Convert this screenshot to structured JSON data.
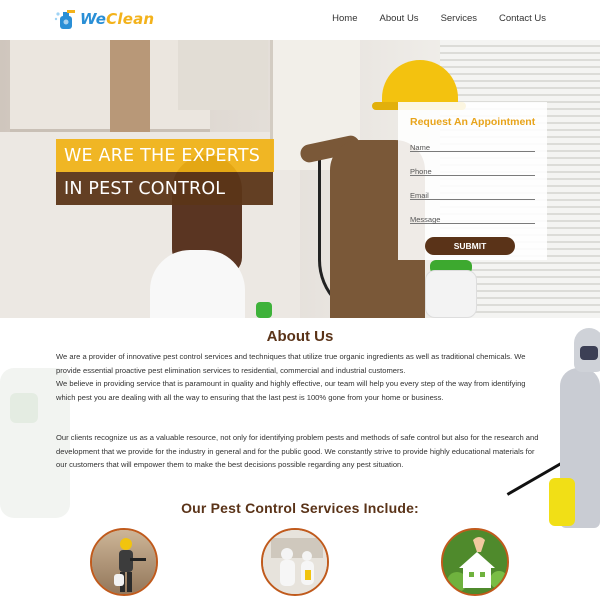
{
  "header": {
    "logo_text_a": "We",
    "logo_text_b": "Clean",
    "nav": [
      {
        "label": "Home"
      },
      {
        "label": "About Us"
      },
      {
        "label": "Services"
      },
      {
        "label": "Contact Us"
      }
    ]
  },
  "hero": {
    "line1": "WE ARE THE EXPERTS",
    "line2": "IN PEST CONTROL"
  },
  "appointment": {
    "title": "Request An Appointment",
    "fields": {
      "name": "Name",
      "phone": "Phone",
      "email": "Email",
      "message": "Message"
    },
    "submit": "SUBMIT"
  },
  "about": {
    "title": "About Us",
    "paragraph1": "We are a provider of innovative pest control services and techniques that utilize true organic ingredients as well as traditional chemicals. We provide essential proactive pest elimination services to residential, commercial and industrial customers.",
    "paragraph1b": "We believe in providing service that is paramount in quality and highly effective, our team will help you every step of the way from identifying which pest you are dealing with all the way to ensuring that the last pest is 100% gone from your home or business.",
    "paragraph2": "Our clients recognize us as a valuable resource, not only for identifying problem pests and methods of safe control but also for the research and development that we provide for the industry in general and for the public good. We constantly strive to provide highly educational materials for our customers that will empower them to make the best decisions possible regarding any pest situation."
  },
  "services": {
    "title": "Our Pest Control Services Include:"
  },
  "colors": {
    "brand_brown": "#5a3318",
    "brand_yellow": "#f0b114",
    "accent_orange": "#e8a41b"
  }
}
